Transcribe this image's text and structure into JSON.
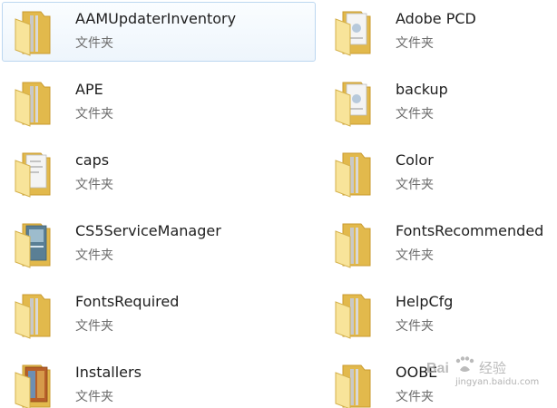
{
  "items": [
    {
      "name": "AAMUpdaterInventory",
      "type": "文件夹",
      "icon": "folder-icon",
      "selected": true
    },
    {
      "name": "Adobe PCD",
      "type": "文件夹",
      "icon": "folder-documents-icon"
    },
    {
      "name": "APE",
      "type": "文件夹",
      "icon": "folder-icon"
    },
    {
      "name": "backup",
      "type": "文件夹",
      "icon": "folder-documents-icon"
    },
    {
      "name": "caps",
      "type": "文件夹",
      "icon": "folder-documents-icon"
    },
    {
      "name": "Color",
      "type": "文件夹",
      "icon": "folder-icon"
    },
    {
      "name": "CS5ServiceManager",
      "type": "文件夹",
      "icon": "folder-documents-icon"
    },
    {
      "name": "FontsRecommended",
      "type": "文件夹",
      "icon": "folder-icon"
    },
    {
      "name": "FontsRequired",
      "type": "文件夹",
      "icon": "folder-icon"
    },
    {
      "name": "HelpCfg",
      "type": "文件夹",
      "icon": "folder-icon"
    },
    {
      "name": "Installers",
      "type": "文件夹",
      "icon": "folder-images-icon"
    },
    {
      "name": "OOBE",
      "type": "文件夹",
      "icon": "folder-icon"
    }
  ],
  "watermark": {
    "logo_text": "Bai 经验",
    "url": "jingyan.baidu.com"
  },
  "colors": {
    "selection_border": "#bcd7f0",
    "folder_back": "#e2b94c",
    "folder_front": "#f8e49a"
  }
}
